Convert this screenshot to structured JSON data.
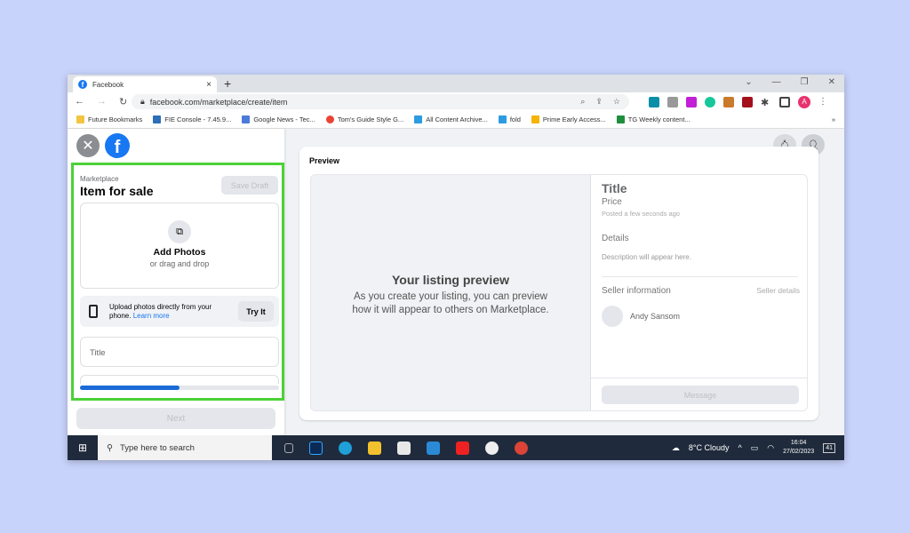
{
  "browser": {
    "tab_title": "Facebook",
    "url": "facebook.com/marketplace/create/item",
    "profile_initial": "A",
    "bookmarks": [
      "Future Bookmarks",
      "FIE Console - 7.45.9...",
      "Google News - Tec...",
      "Tom's Guide Style G...",
      "All Content Archive...",
      "fold",
      "Prime Early Access...",
      "TG Weekly content..."
    ],
    "more": "»"
  },
  "sidebar": {
    "section": "Marketplace",
    "title": "Item for sale",
    "save_draft": "Save Draft",
    "add_photos": "Add Photos",
    "drag_drop": "or drag and drop",
    "upload_text": "Upload photos directly from your phone.",
    "learn_more": "Learn more",
    "try_it": "Try It",
    "title_placeholder": "Title",
    "progress_percent": 50,
    "next": "Next"
  },
  "preview": {
    "label": "Preview",
    "heading": "Your listing preview",
    "body": "As you create your listing, you can preview how it will appear to others on Marketplace.",
    "title": "Title",
    "price": "Price",
    "posted": "Posted a few seconds ago",
    "details": "Details",
    "description": "Description will appear here.",
    "seller_info": "Seller information",
    "seller_details": "Seller details",
    "seller_name": "Andy Sansom",
    "message": "Message"
  },
  "taskbar": {
    "search_placeholder": "Type here to search",
    "weather": "8°C  Cloudy",
    "time": "16:04",
    "date": "27/02/2023",
    "notifications": "41"
  },
  "colors": {
    "accent": "#1877f2",
    "highlight": "#4cd137",
    "background": "#c8d3fb"
  }
}
